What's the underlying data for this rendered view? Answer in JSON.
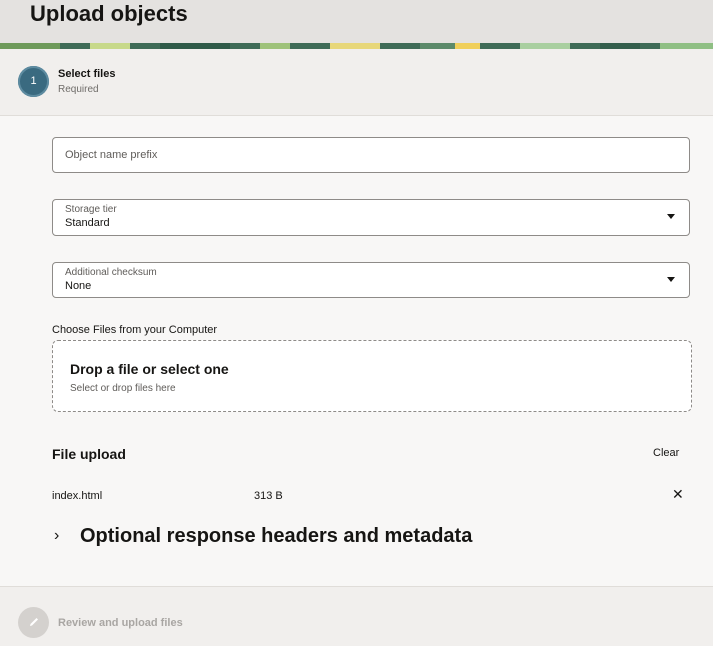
{
  "header": {
    "title": "Upload objects"
  },
  "steps": [
    {
      "number": "1",
      "title": "Select files",
      "status": "Required"
    },
    {
      "title": "Review and upload files",
      "icon": "pencil-icon"
    }
  ],
  "form": {
    "object_name_prefix": {
      "placeholder": "Object name prefix",
      "value": ""
    },
    "storage_tier": {
      "label": "Storage tier",
      "value": "Standard"
    },
    "additional_checksum": {
      "label": "Additional checksum",
      "value": "None"
    }
  },
  "file_chooser": {
    "label": "Choose Files from your Computer",
    "drop_title": "Drop a file or select one",
    "drop_sub": "Select or drop files here"
  },
  "file_upload": {
    "title": "File upload",
    "clear_label": "Clear",
    "files": [
      {
        "name": "index.html",
        "size": "313 B"
      }
    ]
  },
  "optional_section": {
    "title": "Optional response headers and metadata"
  },
  "colors": {
    "accent": "#3a6a80",
    "banner": "#3f6b57"
  }
}
